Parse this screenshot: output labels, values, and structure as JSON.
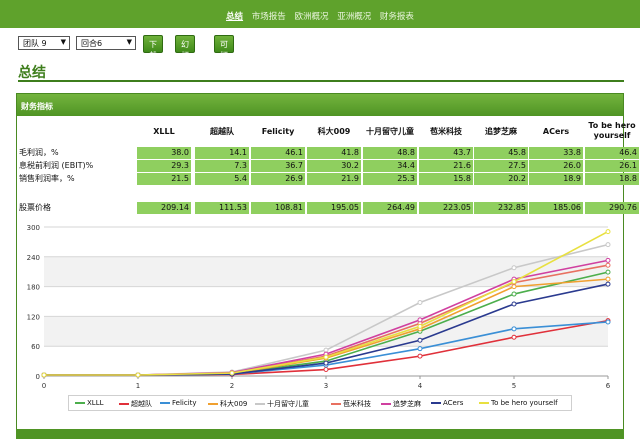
{
  "nav": {
    "items": [
      "总结",
      "市场报告",
      "欧洲概况",
      "亚洲概况",
      "财务报表"
    ],
    "active_index": 0
  },
  "toolbar": {
    "team_select": "团队 9",
    "round_select": "回合6",
    "download_label": "下载",
    "slideshow_label": "幻灯片",
    "print_label": "可打印版本"
  },
  "page": {
    "title": "总结"
  },
  "financials": {
    "panel_title": "财务指标",
    "teams": [
      "XLLL",
      "超越队",
      "Felicity",
      "科大009",
      "十月留守儿童",
      "苞米科技",
      "追梦芝麻",
      "ACers",
      "To be hero yourself"
    ],
    "rows": [
      {
        "label": "毛利润，%",
        "values": [
          "38.0",
          "14.1",
          "46.1",
          "41.8",
          "48.8",
          "43.7",
          "45.8",
          "33.8",
          "46.4"
        ]
      },
      {
        "label": "息税前利润 (EBIT)%",
        "values": [
          "29.3",
          "7.3",
          "36.7",
          "30.2",
          "34.4",
          "21.6",
          "27.5",
          "26.0",
          "26.1"
        ]
      },
      {
        "label": "销售利润率，%",
        "values": [
          "21.5",
          "5.4",
          "26.9",
          "21.9",
          "25.3",
          "15.8",
          "20.2",
          "18.9",
          "18.8"
        ]
      }
    ],
    "share_label": "股票价格",
    "share_values": [
      "209.14",
      "111.53",
      "108.81",
      "195.05",
      "264.49",
      "223.05",
      "232.85",
      "185.06",
      "290.76"
    ]
  },
  "chart_data": {
    "type": "line",
    "x": [
      0,
      1,
      2,
      3,
      4,
      5,
      6
    ],
    "xlim": [
      0,
      6
    ],
    "ylim": [
      0,
      300
    ],
    "yticks": [
      0,
      60,
      120,
      180,
      240,
      300
    ],
    "grid": true,
    "legend_position": "bottom",
    "series": [
      {
        "name": "XLLL",
        "color": "#4cae4c",
        "values": [
          2,
          2,
          5,
          30,
          90,
          165,
          209.14
        ]
      },
      {
        "name": "超越队",
        "color": "#e0303a",
        "values": [
          2,
          2,
          3,
          13,
          40,
          78,
          111.53
        ]
      },
      {
        "name": "Felicity",
        "color": "#3a8fd6",
        "values": [
          2,
          2,
          4,
          22,
          55,
          95,
          108.81
        ]
      },
      {
        "name": "科大009",
        "color": "#f0a030",
        "values": [
          2,
          2,
          5,
          36,
          95,
          180,
          195.05
        ]
      },
      {
        "name": "十月留守儿童",
        "color": "#c8c8c8",
        "values": [
          2,
          2,
          8,
          52,
          148,
          218,
          264.49
        ]
      },
      {
        "name": "苞米科技",
        "color": "#e87060",
        "values": [
          2,
          2,
          6,
          40,
          106,
          188,
          223.05
        ]
      },
      {
        "name": "追梦芝麻",
        "color": "#d040a0",
        "values": [
          2,
          2,
          7,
          44,
          113,
          195,
          232.85
        ]
      },
      {
        "name": "ACers",
        "color": "#2a3a8f",
        "values": [
          2,
          2,
          4,
          26,
          72,
          145,
          185.06
        ]
      },
      {
        "name": "To be hero yourself",
        "color": "#e8e040",
        "values": [
          2,
          2,
          6,
          38,
          100,
          190,
          290.76
        ]
      }
    ]
  }
}
